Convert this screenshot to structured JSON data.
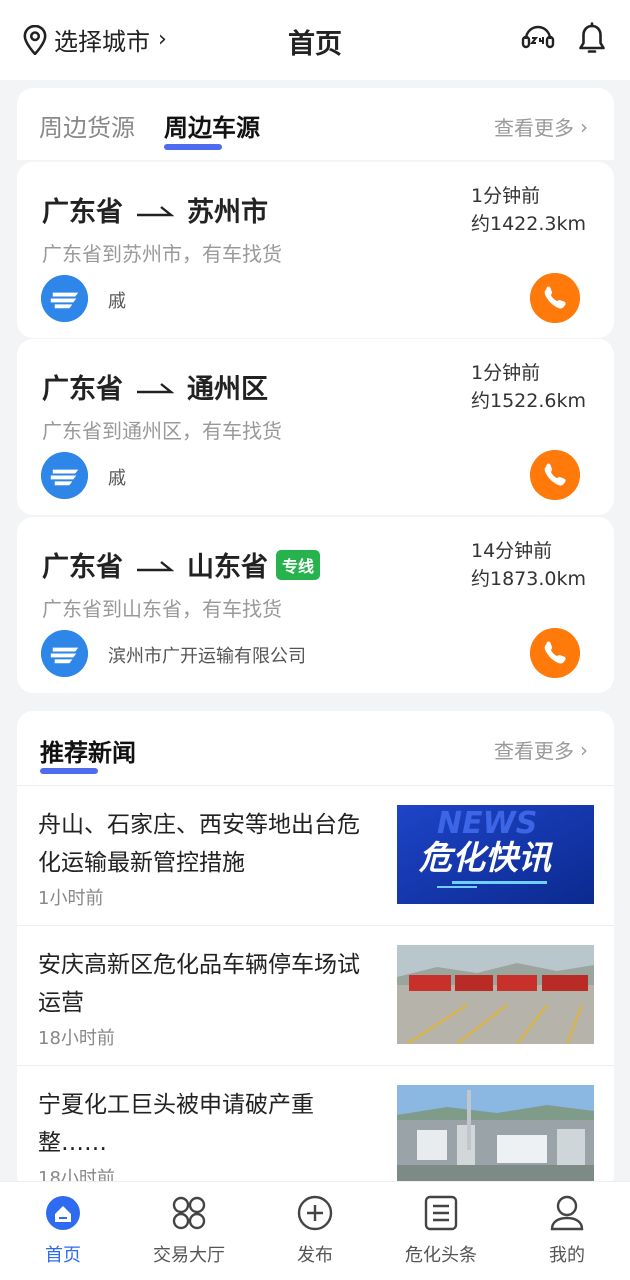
{
  "header": {
    "city_label": "选择城市",
    "city_chevron": "›",
    "title": "首页",
    "icons": [
      "location-pin-icon",
      "customer-service-24h-icon",
      "bell-icon"
    ]
  },
  "tabs": {
    "items": [
      "周边货源",
      "周边车源"
    ],
    "active_index": 1,
    "more_label": "查看更多"
  },
  "cargo": [
    {
      "from": "广东省",
      "to": "苏州市",
      "badge": "",
      "desc": "广东省到苏州市，有车找货",
      "time": "1分钟前",
      "distance": "约1422.3km",
      "owner": "戚"
    },
    {
      "from": "广东省",
      "to": "通州区",
      "badge": "",
      "desc": "广东省到通州区，有车找货",
      "time": "1分钟前",
      "distance": "约1522.6km",
      "owner": "戚"
    },
    {
      "from": "广东省",
      "to": "山东省",
      "badge": "专线",
      "desc": "广东省到山东省，有车找货",
      "time": "14分钟前",
      "distance": "约1873.0km",
      "owner": "滨州市广开运输有限公司"
    }
  ],
  "news": {
    "title": "推荐新闻",
    "more_label": "查看更多",
    "items": [
      {
        "text": "舟山、石家庄、西安等地出台危化运输最新管控措施",
        "time": "1小时前",
        "thumb_text": "危化快讯"
      },
      {
        "text": "安庆高新区危化品车辆停车场试运营",
        "time": "18小时前"
      },
      {
        "text": "宁夏化工巨头被申请破产重整……",
        "time": "18小时前"
      }
    ]
  },
  "nav": {
    "items": [
      "首页",
      "交易大厅",
      "发布",
      "危化头条",
      "我的"
    ],
    "active_index": 0
  },
  "colors": {
    "accent": "#4f6bf0",
    "phone": "#ff7a0a",
    "badge": "#26b24d",
    "nav_active": "#2f6bf0",
    "avatar": "#2e86e8"
  }
}
